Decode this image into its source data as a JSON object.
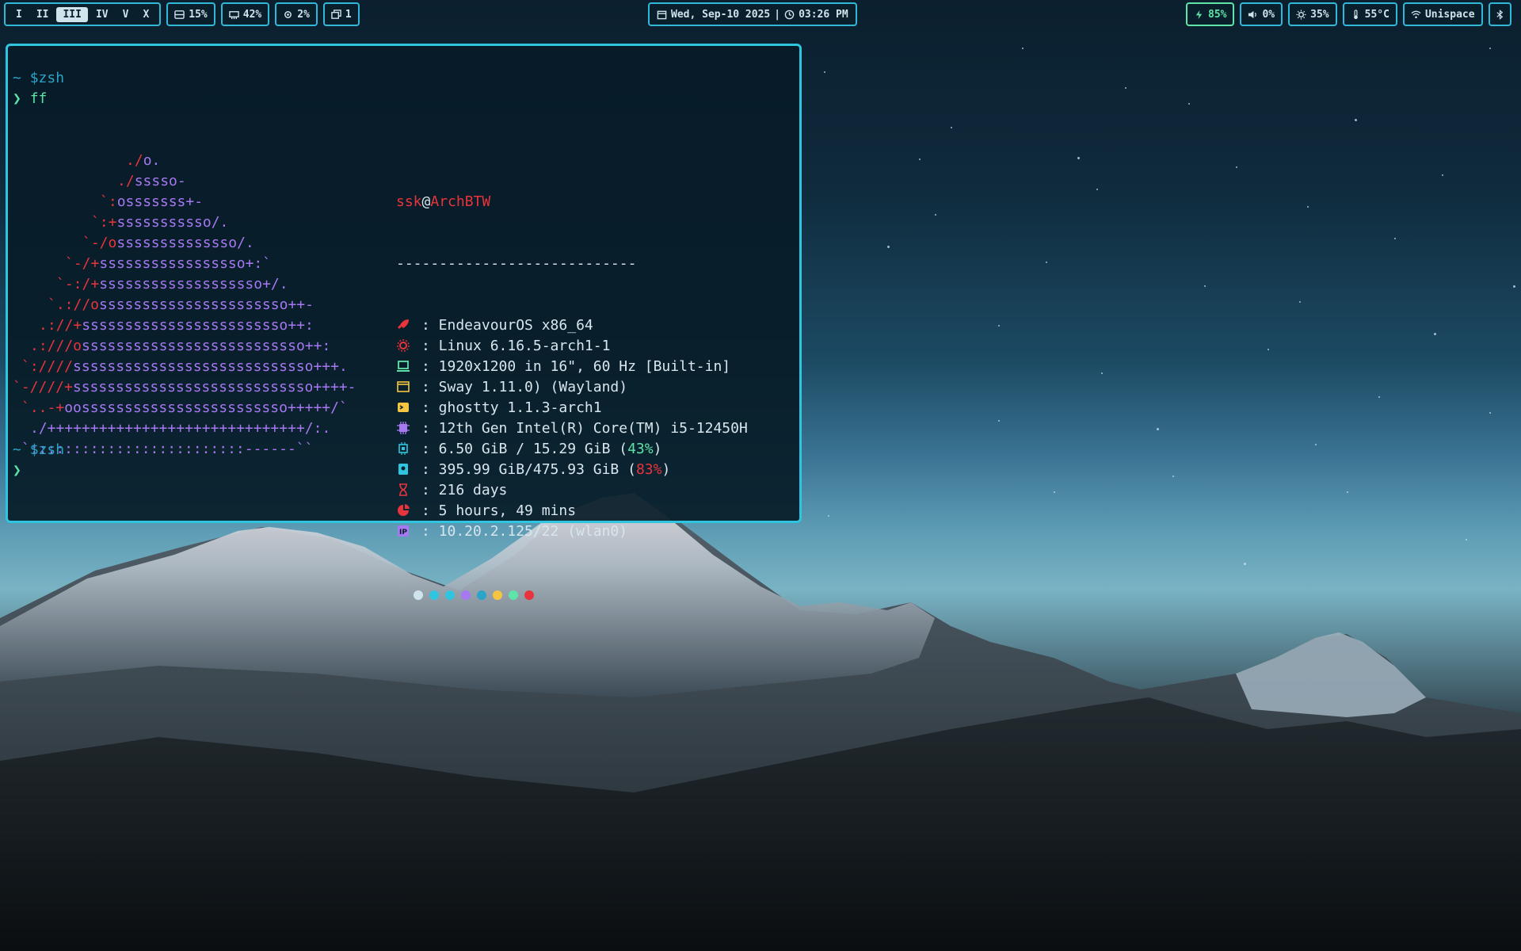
{
  "bar": {
    "workspaces": [
      "I",
      "II",
      "III",
      "IV",
      "V",
      "X"
    ],
    "active_workspace": "III",
    "disk": "15%",
    "memory": "42%",
    "cpu": "2%",
    "windows": "1",
    "date": "Wed, Sep-10 2025",
    "separator": "|",
    "time": "03:26 PM",
    "battery": "85%",
    "volume": "0%",
    "brightness": "35%",
    "temperature": "55°C",
    "network": "Unispace"
  },
  "terminal": {
    "prompt1_tilde": "~",
    "prompt1_shell": "$zsh",
    "cmd_arrow": "❯",
    "command": "ff",
    "prompt2_tilde": "~",
    "prompt2_shell": "$zsh",
    "cursor_arrow": "❯",
    "user": "ssk",
    "at": "@",
    "host": "ArchBTW",
    "rule": "----------------------------",
    "info": [
      {
        "icon": "rocket-icon",
        "color": "#e8343c",
        "text": ": EndeavourOS x86_64"
      },
      {
        "icon": "gear-icon",
        "color": "#e8343c",
        "text": ": Linux 6.16.5-arch1-1"
      },
      {
        "icon": "laptop-icon",
        "color": "#5ee3a8",
        "text": ": 1920x1200 in 16\", 60 Hz [Built-in]"
      },
      {
        "icon": "window-icon",
        "color": "#f5c542",
        "text": ": Sway 1.11.0) (Wayland)"
      },
      {
        "icon": "terminal-icon",
        "color": "#f5c542",
        "text": ": ghostty 1.1.3-arch1"
      },
      {
        "icon": "cpu-icon",
        "color": "#a678f2",
        "text": ": 12th Gen Intel(R) Core(TM) i5-12450H"
      },
      {
        "icon": "memory-icon",
        "color": "#2fc5e0",
        "text": ": 6.50 GiB / 15.29 GiB (",
        "pct": "43%",
        "pct_color": "#5ee3a8",
        "tail": ")"
      },
      {
        "icon": "disk-icon",
        "color": "#2fc5e0",
        "text": ": 395.99 GiB/475.93 GiB (",
        "pct": "83%",
        "pct_color": "#e8343c",
        "tail": ")"
      },
      {
        "icon": "hourglass-icon",
        "color": "#e8343c",
        "text": ": 216 days"
      },
      {
        "icon": "pie-icon",
        "color": "#e8343c",
        "text": ": 5 hours, 49 mins"
      },
      {
        "icon": "ip-icon",
        "color": "#a678f2",
        "text": ": 10.20.2.125/22 (wlan0)"
      }
    ],
    "palette": [
      "#cfe3ec",
      "#2fc5e0",
      "#2fc5e0",
      "#a678f2",
      "#2aa5c9",
      "#f5c542",
      "#5ee3a8",
      "#e8343c"
    ],
    "logo": [
      [
        [
          "red",
          "./"
        ],
        [
          "purple",
          "o."
        ]
      ],
      [
        [
          "red",
          "./"
        ],
        [
          "purple",
          "sssso-"
        ]
      ],
      [
        [
          "red",
          "`:"
        ],
        [
          "purple",
          "osssssss+-"
        ]
      ],
      [
        [
          "red",
          "`:+"
        ],
        [
          "purple",
          "sssssssssso/."
        ]
      ],
      [
        [
          "red",
          "`-/o"
        ],
        [
          "purple",
          "ssssssssssssso/."
        ]
      ],
      [
        [
          "red",
          "`-/+"
        ],
        [
          "purple",
          "sssssssssssssssso+:`"
        ]
      ],
      [
        [
          "red",
          "`-:/+"
        ],
        [
          "purple",
          "sssssssssssssssssso+/."
        ]
      ],
      [
        [
          "red",
          "`.://o"
        ],
        [
          "purple",
          "ssssssssssssssssssssso++-"
        ]
      ],
      [
        [
          "red",
          ".://+"
        ],
        [
          "purple",
          "ssssssssssssssssssssssso++:"
        ]
      ],
      [
        [
          "red",
          ".:///o"
        ],
        [
          "purple",
          "ssssssssssssssssssssssssso++:"
        ]
      ],
      [
        [
          "red",
          "`:////"
        ],
        [
          "purple",
          "ssssssssssssssssssssssssssso+++."
        ]
      ],
      [
        [
          "red",
          "`-////+"
        ],
        [
          "purple",
          "ssssssssssssssssssssssssssso++++-"
        ]
      ],
      [
        [
          "red",
          "`..-+"
        ],
        [
          "purple",
          "oossssssssssssssssssssssso+++++/`"
        ]
      ],
      [
        [
          "red",
          ""
        ],
        [
          "purple",
          "./++++++++++++++++++++++++++++++/:."
        ]
      ],
      [
        [
          "red",
          ""
        ],
        [
          "purple",
          "`:::::::::::::::::::::::::------``"
        ]
      ]
    ]
  }
}
